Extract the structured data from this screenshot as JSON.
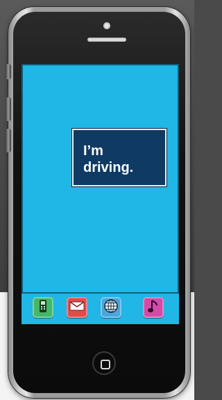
{
  "message": {
    "text_line1": "I’m",
    "text_line2": "driving."
  },
  "dock": {
    "apps": [
      {
        "icon": "phone-icon",
        "color": "#42b86a"
      },
      {
        "icon": "mail-icon",
        "color": "#e24b4b"
      },
      {
        "icon": "globe-icon",
        "color": "#4aa6de"
      },
      {
        "icon": "music-icon",
        "color": "#d44aa8"
      }
    ]
  },
  "colors": {
    "screen": "#20b6e5",
    "message_bg": "#0f3a63"
  }
}
